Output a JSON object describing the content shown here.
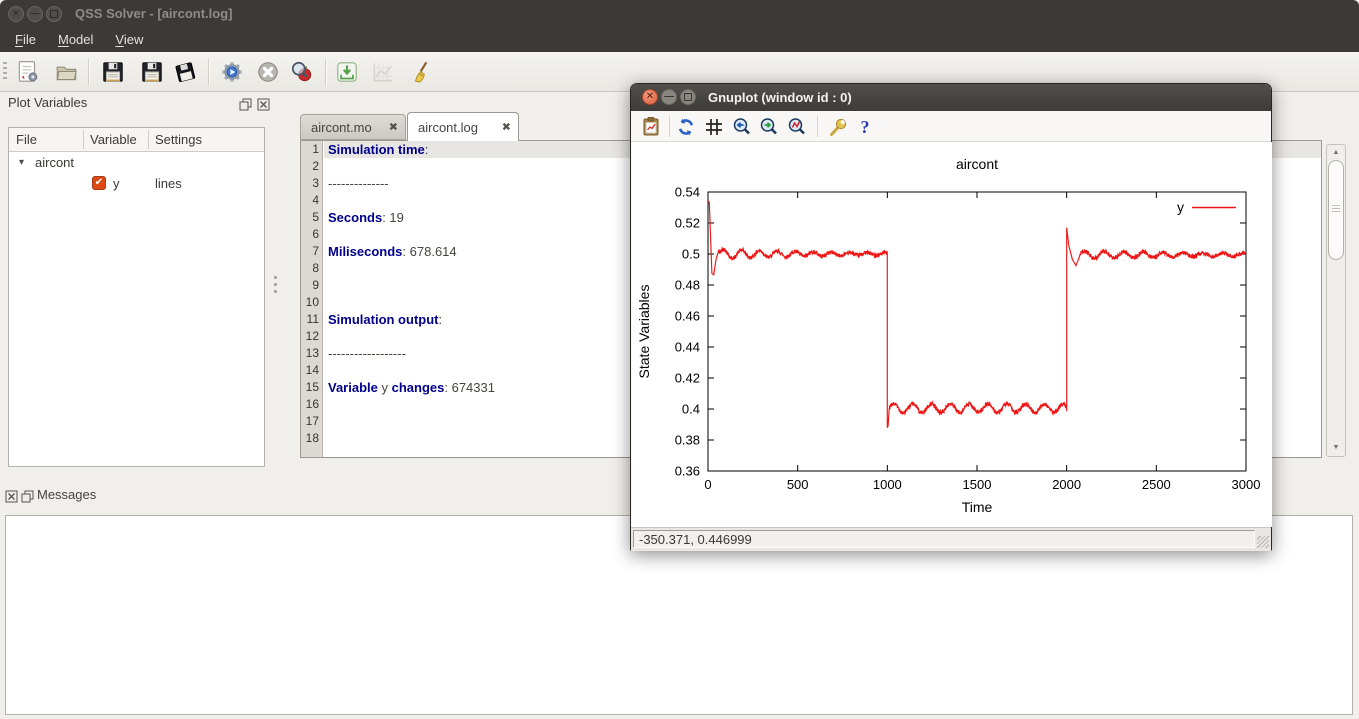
{
  "window": {
    "title": "QSS Solver - [aircont.log]"
  },
  "menu": {
    "items": [
      "File",
      "Model",
      "View"
    ]
  },
  "toolbar": {
    "buttons": [
      "new-model",
      "open-model",
      "save",
      "save-as",
      "export-log",
      "build-run",
      "abort",
      "debug",
      "import",
      "plot",
      "clean"
    ]
  },
  "plot_variables": {
    "title": "Plot Variables",
    "columns": [
      "File",
      "Variable",
      "Settings"
    ],
    "rows": [
      {
        "type": "file",
        "label": "aircont",
        "expanded": true
      },
      {
        "type": "variable",
        "label": "y",
        "checked": true,
        "settings": "lines"
      }
    ]
  },
  "tabs": [
    {
      "label": "aircont.mo",
      "active": false
    },
    {
      "label": "aircont.log",
      "active": true
    }
  ],
  "editor": {
    "lines": [
      {
        "num": "1",
        "highlight": true,
        "segs": [
          {
            "t": "Simulation time",
            "b": true
          },
          {
            "t": ":",
            "b": false
          }
        ]
      },
      {
        "num": "2",
        "segs": []
      },
      {
        "num": "3",
        "segs": [
          {
            "t": "--------------",
            "b": false
          }
        ]
      },
      {
        "num": "4",
        "segs": []
      },
      {
        "num": "5",
        "segs": [
          {
            "t": "Seconds",
            "b": true
          },
          {
            "t": ": 19",
            "b": false
          }
        ]
      },
      {
        "num": "6",
        "segs": []
      },
      {
        "num": "7",
        "segs": [
          {
            "t": "Miliseconds",
            "b": true
          },
          {
            "t": ": 678.614",
            "b": false
          }
        ]
      },
      {
        "num": "8",
        "segs": []
      },
      {
        "num": "9",
        "segs": []
      },
      {
        "num": "10",
        "segs": []
      },
      {
        "num": "11",
        "segs": [
          {
            "t": "Simulation output",
            "b": true
          },
          {
            "t": ":",
            "b": false
          }
        ]
      },
      {
        "num": "12",
        "segs": []
      },
      {
        "num": "13",
        "segs": [
          {
            "t": "------------------",
            "b": false
          }
        ]
      },
      {
        "num": "14",
        "segs": []
      },
      {
        "num": "15",
        "segs": [
          {
            "t": "Variable",
            "b": true
          },
          {
            "t": " y ",
            "b": false
          },
          {
            "t": "changes",
            "b": true
          },
          {
            "t": ": 674331",
            "b": false
          }
        ]
      },
      {
        "num": "16",
        "segs": []
      },
      {
        "num": "17",
        "segs": []
      },
      {
        "num": "18",
        "segs": []
      }
    ]
  },
  "messages": {
    "title": "Messages"
  },
  "gnuplot": {
    "title": "Gnuplot (window id : 0)",
    "toolbar": [
      "copy-plot",
      "refresh",
      "grid",
      "zoom-previous",
      "zoom-next",
      "zoom-reset",
      "settings",
      "help"
    ],
    "status": "-350.371, 0.446999"
  },
  "colors": {
    "series_red": "#ed1515",
    "log_label_navy": "#00008b",
    "checkbox_orange": "#dd4814",
    "titlebar_dark": "#3b3a36"
  },
  "chart_data": {
    "type": "line",
    "title": "aircont",
    "xlabel": "Time",
    "ylabel": "State Variables",
    "xlim": [
      0,
      3000
    ],
    "ylim": [
      0.36,
      0.54
    ],
    "xticks": [
      0,
      500,
      1000,
      1500,
      2000,
      2500,
      3000
    ],
    "xtick_labels": [
      "0",
      "500",
      "1000",
      "1500",
      "2000",
      "2500",
      "3000"
    ],
    "yticks": [
      0.36,
      0.38,
      0.4,
      0.42,
      0.44,
      0.46,
      0.48,
      0.5,
      0.52,
      0.54
    ],
    "ytick_labels": [
      "0.36",
      "0.38",
      "0.4",
      "0.42",
      "0.44",
      "0.46",
      "0.48",
      "0.5",
      "0.52",
      "0.54"
    ],
    "grid": false,
    "legend_position": "top-right",
    "series": [
      {
        "name": "y",
        "color": "#ed1515",
        "description": "Noisy controlled state: spike 0.534 at t=0 with undershoot to 0.486 then ripples about 0.5 until t=1000; steps down (undershoot 0.388) and ripples about 0.4 until t=2000; overshoot spike 0.517 at t=2000 then ripples about 0.5 until t=3000; ripple amplitude about 0.004.",
        "noise_seed": 42,
        "segments": [
          {
            "range": [
              0,
              1000
            ],
            "level": 0.5,
            "entry": [
              [
                0,
                0.534
              ],
              [
                7,
                0.5335
              ],
              [
                22,
                0.4875
              ],
              [
                32,
                0.4865
              ],
              [
                46,
                0.497
              ],
              [
                62,
                0.503
              ]
            ],
            "osc_amp": 0.0032,
            "osc_period": 100,
            "osc_decay": 650,
            "noise": 0.0013
          },
          {
            "range": [
              1000,
              2000
            ],
            "level": 0.4005,
            "entry": [
              [
                1000,
                0.4995
              ],
              [
                1000,
                0.388
              ],
              [
                1004,
                0.389
              ],
              [
                1010,
                0.3995
              ]
            ],
            "osc_amp": 0.0028,
            "osc_period": 105,
            "osc_decay": 99999,
            "noise": 0.0014
          },
          {
            "range": [
              2000,
              3000
            ],
            "level": 0.4995,
            "entry": [
              [
                2000,
                0.3985
              ],
              [
                2000,
                0.517
              ],
              [
                2012,
                0.5055
              ],
              [
                2032,
                0.4965
              ],
              [
                2052,
                0.4925
              ],
              [
                2072,
                0.4985
              ]
            ],
            "osc_amp": 0.0026,
            "osc_period": 110,
            "osc_decay": 900,
            "noise": 0.0013
          }
        ]
      }
    ]
  }
}
